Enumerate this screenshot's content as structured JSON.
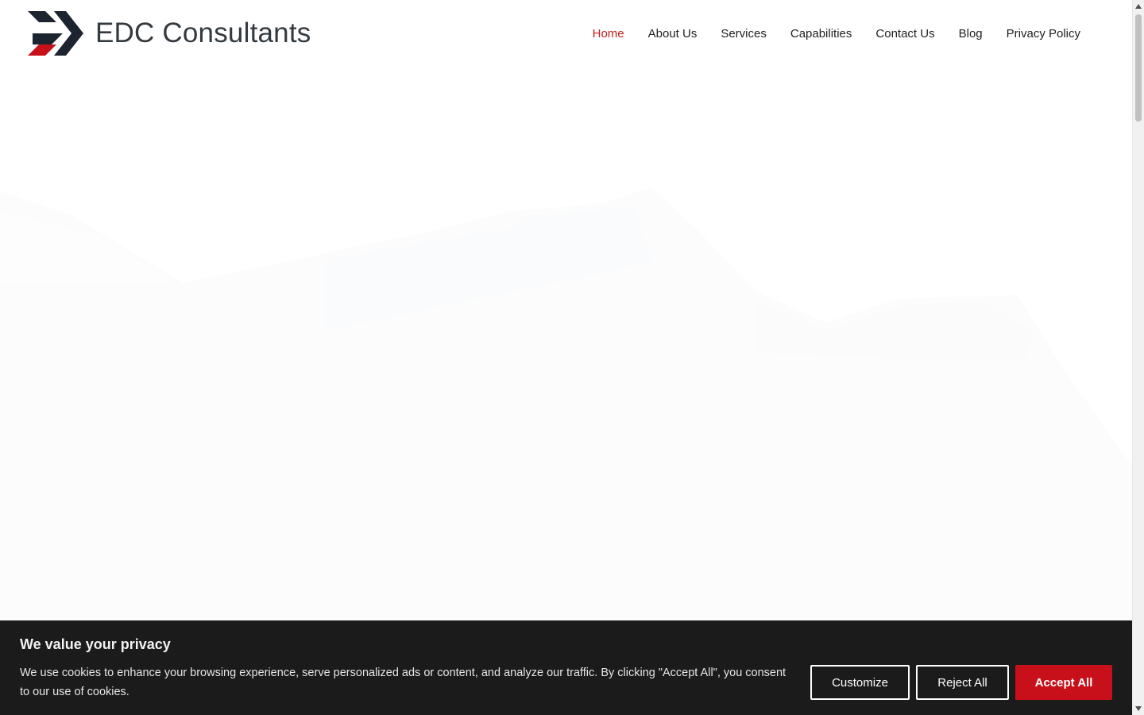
{
  "brand": {
    "name": "EDC Consultants",
    "logo_icon": "edc-chevron-logo-icon",
    "colors": {
      "dark": "#1c2430",
      "accent": "#c8101a"
    }
  },
  "nav": {
    "items": [
      {
        "label": "Home",
        "active": true
      },
      {
        "label": "About Us",
        "active": false
      },
      {
        "label": "Services",
        "active": false
      },
      {
        "label": "Capabilities",
        "active": false
      },
      {
        "label": "Contact Us",
        "active": false
      },
      {
        "label": "Blog",
        "active": false
      },
      {
        "label": "Privacy Policy",
        "active": false
      }
    ],
    "active_color": "#c41e1e"
  },
  "cookie_banner": {
    "title": "We value your privacy",
    "text": "We use cookies to enhance your browsing experience, serve personalized ads or content, and analyze our traffic. By clicking \"Accept All\", you consent to our use of cookies.",
    "buttons": {
      "customize": "Customize",
      "reject": "Reject All",
      "accept": "Accept All"
    },
    "background": "#1b1b1b",
    "accept_color": "#c8101a"
  }
}
